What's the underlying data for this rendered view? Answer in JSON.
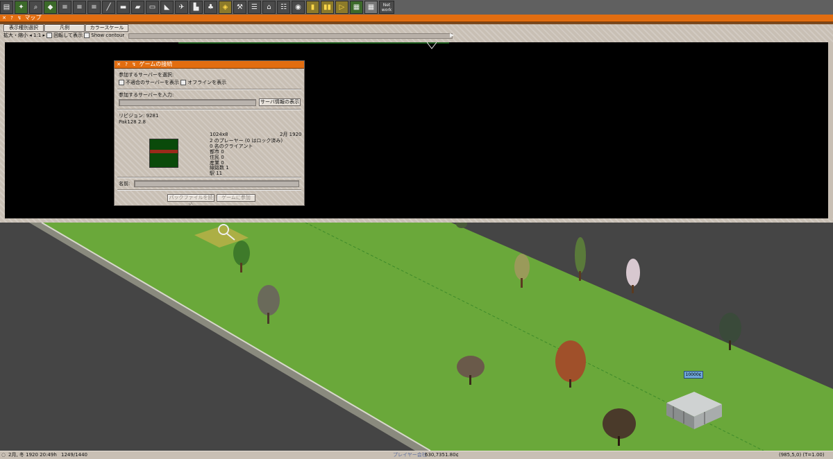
{
  "toolbar": {
    "icons": [
      "save-icon",
      "minimap-icon",
      "magnifier-icon",
      "slope-tool-icon",
      "road-tool-icon",
      "rail-tool-icon",
      "ship-tool-icon",
      "tram-tool-icon",
      "rail-car-tool-icon",
      "road-vehicle-tool-icon",
      "train-tool-icon",
      "aircraft-tool-icon",
      "boat-tool-icon",
      "airport-tool-icon",
      "monorail-tool-icon",
      "maglev-tool-icon",
      "pipeline-tool-icon",
      "special-tool-icon",
      "finance-icon",
      "list-icon",
      "camera-icon",
      "screenshot-icon",
      "info-icon",
      "pause-icon",
      "fast-forward-icon",
      "layer-icon",
      "grid-icon",
      "network-icon"
    ],
    "network_label": "Net work"
  },
  "map_window": {
    "title": "マップ",
    "buttons": {
      "display_select": "表示種別選択",
      "legend": "凡例",
      "color_scale": "カラースケール"
    },
    "zoom_label": "拡大・縮小",
    "zoom_value": "1:1",
    "rotate_label": "回転して表示",
    "contour_label": "Show contour"
  },
  "dialog": {
    "title": "ゲームの接続",
    "select_server_label": "参加するサーバーを選択:",
    "show_incompatible_label": "不適合のサーバーを表示",
    "show_offline_label": "オフラインを表示",
    "enter_server_label": "参加するサーバーを入力:",
    "show_server_status_button": "サーバ情報の表示",
    "revision_label": "リビジョン: 9281",
    "pak_label": "Pak128 2.8",
    "map_size": "1024x8",
    "date": "2月 1920",
    "stats": [
      "2 のプレーヤー (0 はロック済み)",
      "0 名のクライアント",
      "都市 0",
      "住民 0",
      "産業 0",
      "線路数 1",
      "駅 11"
    ],
    "name_label": "名前:",
    "buttons": {
      "load_pak": "パックファイルを読込",
      "join_game": "ゲームに参加"
    }
  },
  "world": {
    "price_label": "10000¢"
  },
  "statusbar": {
    "date_time": "2月, 冬 1920 20:49h",
    "zoom": "1249/1440",
    "player_label": "プレイヤー会社",
    "money": "630,7351.80¢",
    "coords": "(985,5,0) (T=1.00)"
  },
  "colors": {
    "title_orange": "#e26d10",
    "grass_green": "#6aa83a",
    "minimap_green": "#0a4a0a",
    "minimap_red": "#9a2a1a"
  }
}
